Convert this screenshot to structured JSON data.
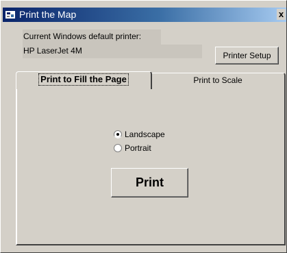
{
  "window": {
    "title": "Print the Map",
    "close_label": "x"
  },
  "printer": {
    "label": "Current Windows default printer:",
    "name": "HP LaserJet 4M",
    "setup_button": "Printer Setup"
  },
  "tabs": [
    {
      "label": "Print to Fill the Page",
      "selected": true
    },
    {
      "label": "Print to Scale",
      "selected": false
    }
  ],
  "orientation": {
    "selected": "Landscape",
    "options": [
      "Landscape",
      "Portrait"
    ]
  },
  "print_button": "Print",
  "colors": {
    "face": "#d4d0c8",
    "title_start": "#0a246a",
    "title_end": "#a6caf0"
  }
}
